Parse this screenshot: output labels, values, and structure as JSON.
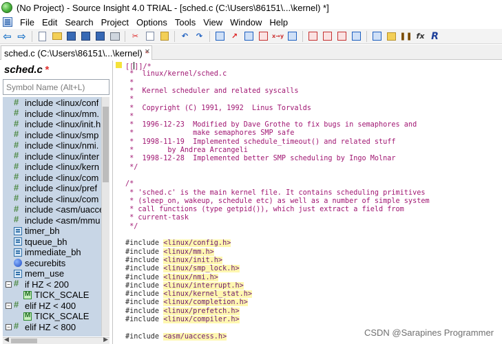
{
  "window": {
    "title": "(No Project) - Source Insight 4.0 TRIAL - [sched.c (C:\\Users\\86151\\...\\kernel) *]"
  },
  "menu": {
    "items": [
      "File",
      "Edit",
      "Search",
      "Project",
      "Options",
      "Tools",
      "View",
      "Window",
      "Help"
    ]
  },
  "toolbar": {
    "buttons": [
      "back-arrow",
      "forward-arrow",
      "new-file",
      "open-folder",
      "save",
      "save-all",
      "save-multiple",
      "print",
      "cut",
      "copy",
      "paste",
      "undo",
      "redo",
      "browse",
      "jump",
      "lookup",
      "replace-xy",
      "rename",
      "bookmark-red",
      "bookmark-blue",
      "bookmark-next",
      "home",
      "symbol-window",
      "keyword",
      "reference",
      "fx",
      "relation"
    ]
  },
  "tab": {
    "label": "sched.c (C:\\Users\\86151\\...\\kernel)",
    "modified": "*"
  },
  "symbol_panel": {
    "title": "sched.c",
    "modified": "*",
    "search_placeholder": "Symbol Name (Alt+L)",
    "items": [
      {
        "text": "include <linux/conf",
        "icon": "include",
        "indent": 0
      },
      {
        "text": "include <linux/mm.",
        "icon": "include",
        "indent": 0
      },
      {
        "text": "include <linux/init.h",
        "icon": "include",
        "indent": 0
      },
      {
        "text": "include <linux/smp",
        "icon": "include",
        "indent": 0
      },
      {
        "text": "include <linux/nmi.",
        "icon": "include",
        "indent": 0
      },
      {
        "text": "include <linux/inter",
        "icon": "include",
        "indent": 0
      },
      {
        "text": "include <linux/kern",
        "icon": "include",
        "indent": 0
      },
      {
        "text": "include <linux/com",
        "icon": "include",
        "indent": 0
      },
      {
        "text": "include <linux/pref",
        "icon": "include",
        "indent": 0
      },
      {
        "text": "include <linux/com",
        "icon": "include",
        "indent": 0
      },
      {
        "text": "include <asm/uacce",
        "icon": "include",
        "indent": 0
      },
      {
        "text": "include <asm/mmu",
        "icon": "include",
        "indent": 0
      },
      {
        "text": "timer_bh",
        "icon": "macro",
        "indent": 0
      },
      {
        "text": "tqueue_bh",
        "icon": "macro",
        "indent": 0
      },
      {
        "text": "immediate_bh",
        "icon": "macro",
        "indent": 0
      },
      {
        "text": "securebits",
        "icon": "var",
        "indent": 0
      },
      {
        "text": "mem_use",
        "icon": "macro",
        "indent": 0
      },
      {
        "text": "if HZ < 200",
        "icon": "include",
        "indent": 0,
        "expander": "−"
      },
      {
        "text": "TICK_SCALE",
        "icon": "const",
        "indent": 1
      },
      {
        "text": "elif HZ < 400",
        "icon": "include",
        "indent": 0,
        "expander": "−"
      },
      {
        "text": "TICK_SCALE",
        "icon": "const",
        "indent": 1
      },
      {
        "text": "elif HZ < 800",
        "icon": "include",
        "indent": 0,
        "expander": "−"
      }
    ]
  },
  "editor": {
    "lines": [
      {
        "segs": [
          {
            "t": "[[",
            "c": "c-comment"
          },
          {
            "t": "CURSOR",
            "c": "cursor"
          },
          {
            "t": "]]/*",
            "c": "c-comment"
          }
        ]
      },
      {
        "segs": [
          {
            "t": " *  linux/kernel/sched.c",
            "c": "c-comment"
          }
        ]
      },
      {
        "segs": [
          {
            "t": " *",
            "c": "c-comment"
          }
        ]
      },
      {
        "segs": [
          {
            "t": " *  Kernel scheduler and related syscalls",
            "c": "c-comment"
          }
        ]
      },
      {
        "segs": [
          {
            "t": " *",
            "c": "c-comment"
          }
        ]
      },
      {
        "segs": [
          {
            "t": " *  Copyright (C) 1991, 1992  Linus Torvalds",
            "c": "c-comment"
          }
        ]
      },
      {
        "segs": [
          {
            "t": " *",
            "c": "c-comment"
          }
        ]
      },
      {
        "segs": [
          {
            "t": " *  1996-12-23  Modified by Dave Grothe to fix bugs in semaphores and",
            "c": "c-comment"
          }
        ]
      },
      {
        "segs": [
          {
            "t": " *              make semaphores SMP safe",
            "c": "c-comment"
          }
        ]
      },
      {
        "segs": [
          {
            "t": " *  1998-11-19  Implemented schedule_timeout() and related stuff",
            "c": "c-comment"
          }
        ]
      },
      {
        "segs": [
          {
            "t": " *        by Andrea Arcangeli",
            "c": "c-comment"
          }
        ]
      },
      {
        "segs": [
          {
            "t": " *  1998-12-28  Implemented better SMP scheduling by Ingo Molnar",
            "c": "c-comment"
          }
        ]
      },
      {
        "segs": [
          {
            "t": " */",
            "c": "c-comment"
          }
        ]
      },
      {
        "segs": [
          {
            "t": "",
            "c": "c-comment"
          }
        ]
      },
      {
        "segs": [
          {
            "t": "/*",
            "c": "c-comment"
          }
        ]
      },
      {
        "segs": [
          {
            "t": " * 'sched.c' is the main kernel file. It contains scheduling primitives",
            "c": "c-comment"
          }
        ]
      },
      {
        "segs": [
          {
            "t": " * (sleep_on, wakeup, schedule etc) as well as a number of simple system",
            "c": "c-comment"
          }
        ]
      },
      {
        "segs": [
          {
            "t": " * call functions (type getpid()), which just extract a field from",
            "c": "c-comment"
          }
        ]
      },
      {
        "segs": [
          {
            "t": " * current-task",
            "c": "c-comment"
          }
        ]
      },
      {
        "segs": [
          {
            "t": " */",
            "c": "c-comment"
          }
        ]
      },
      {
        "segs": [
          {
            "t": "",
            "c": "c-comment"
          }
        ]
      },
      {
        "segs": [
          {
            "t": "#include ",
            "c": "c-directive"
          },
          {
            "t": "<linux/config.h>",
            "c": "c-header"
          }
        ]
      },
      {
        "segs": [
          {
            "t": "#include ",
            "c": "c-directive"
          },
          {
            "t": "<linux/mm.h>",
            "c": "c-header"
          }
        ]
      },
      {
        "segs": [
          {
            "t": "#include ",
            "c": "c-directive"
          },
          {
            "t": "<linux/init.h>",
            "c": "c-header"
          }
        ]
      },
      {
        "segs": [
          {
            "t": "#include ",
            "c": "c-directive"
          },
          {
            "t": "<linux/smp_lock.h>",
            "c": "c-header"
          }
        ]
      },
      {
        "segs": [
          {
            "t": "#include ",
            "c": "c-directive"
          },
          {
            "t": "<linux/nmi.h>",
            "c": "c-header"
          }
        ]
      },
      {
        "segs": [
          {
            "t": "#include ",
            "c": "c-directive"
          },
          {
            "t": "<linux/interrupt.h>",
            "c": "c-header"
          }
        ]
      },
      {
        "segs": [
          {
            "t": "#include ",
            "c": "c-directive"
          },
          {
            "t": "<linux/kernel_stat.h>",
            "c": "c-header"
          }
        ]
      },
      {
        "segs": [
          {
            "t": "#include ",
            "c": "c-directive"
          },
          {
            "t": "<linux/completion.h>",
            "c": "c-header"
          }
        ]
      },
      {
        "segs": [
          {
            "t": "#include ",
            "c": "c-directive"
          },
          {
            "t": "<linux/prefetch.h>",
            "c": "c-header"
          }
        ]
      },
      {
        "segs": [
          {
            "t": "#include ",
            "c": "c-directive"
          },
          {
            "t": "<linux/compiler.h>",
            "c": "c-header"
          }
        ]
      },
      {
        "segs": [
          {
            "t": "",
            "c": "c-comment"
          }
        ]
      },
      {
        "segs": [
          {
            "t": "#include ",
            "c": "c-directive"
          },
          {
            "t": "<asm/uaccess.h>",
            "c": "c-header"
          }
        ]
      }
    ]
  },
  "watermark": "CSDN @Sarapines Programmer"
}
